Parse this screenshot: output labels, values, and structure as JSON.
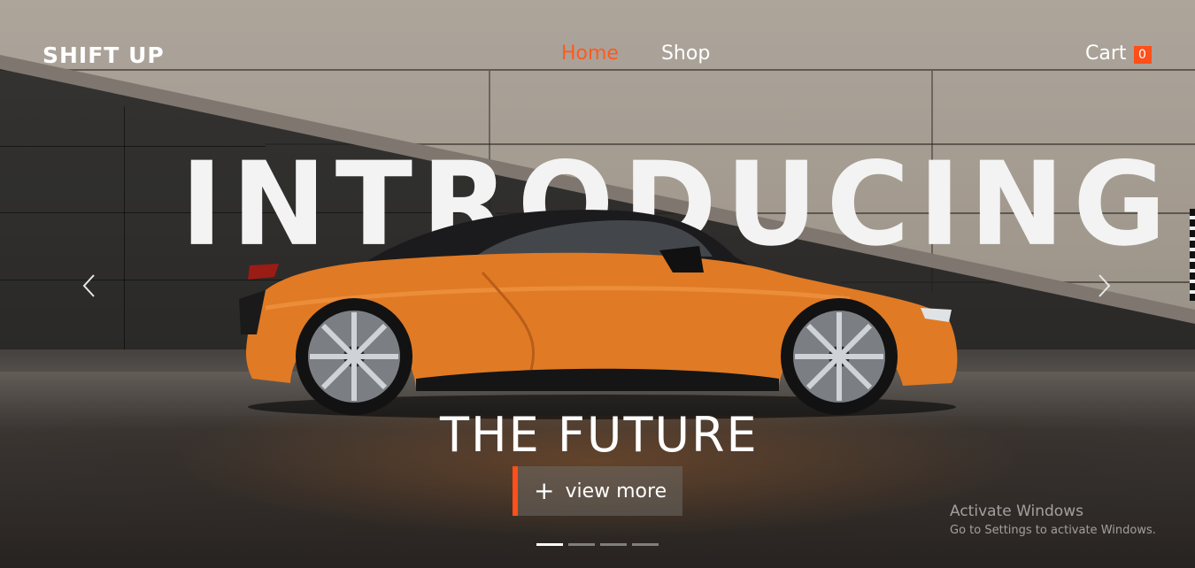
{
  "brand": {
    "logo_text": "SHIFT UP"
  },
  "nav": {
    "items": [
      {
        "label": "Home",
        "active": true
      },
      {
        "label": "Shop",
        "active": false
      }
    ]
  },
  "cart": {
    "label": "Cart",
    "count": "0"
  },
  "hero": {
    "headline": "INTRODUCING",
    "subtitle": "THE FUTURE",
    "cta_label": "view more",
    "slides_total": 4,
    "active_slide": 1
  },
  "watermark": {
    "title": "Activate Windows",
    "subtitle": "Go to Settings to activate Windows."
  },
  "colors": {
    "accent": "#ff4f1a",
    "text": "#ffffff",
    "car": "#e07a25"
  },
  "icons": {
    "prev": "chevron-left-icon",
    "next": "chevron-right-icon",
    "plus": "plus-icon"
  }
}
